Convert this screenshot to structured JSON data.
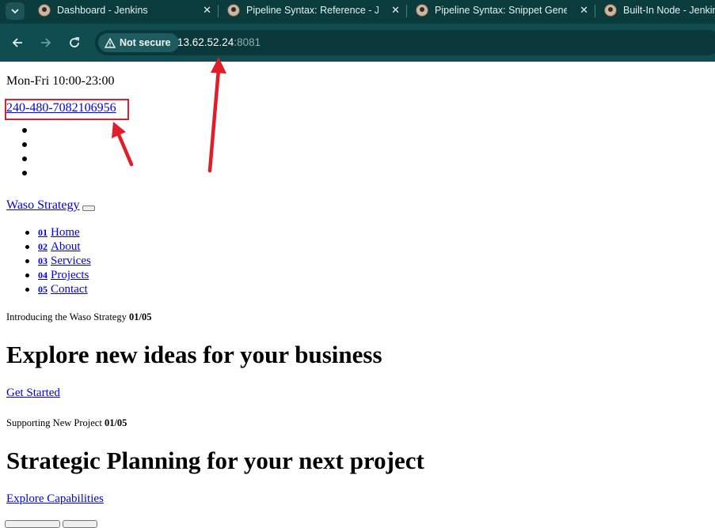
{
  "browser": {
    "tabs": [
      {
        "title": "Dashboard - Jenkins"
      },
      {
        "title": "Pipeline Syntax: Reference - Jenkins"
      },
      {
        "title": "Pipeline Syntax: Snippet Generator"
      },
      {
        "title": "Built-In Node - Jenkins"
      }
    ],
    "security_label": "Not secure",
    "url_host": "13.62.52.24",
    "url_port": ":8081",
    "icons": {
      "menu": "chevron-down-icon",
      "back": "back-arrow-icon",
      "forward": "forward-arrow-icon",
      "reload": "reload-icon",
      "warning": "warning-triangle-icon",
      "close": "close-icon",
      "favicon": "jenkins-favicon-icon"
    }
  },
  "page": {
    "hours": "Mon-Fri 10:00-23:00",
    "phone": "240-480-7082106956",
    "brand": "Waso Strategy",
    "menu": [
      {
        "num": "01",
        "label": "Home"
      },
      {
        "num": "02",
        "label": "About"
      },
      {
        "num": "03",
        "label": "Services"
      },
      {
        "num": "04",
        "label": "Projects"
      },
      {
        "num": "05",
        "label": "Contact"
      }
    ],
    "slides": [
      {
        "kicker": "Introducing the Waso Strategy",
        "counter": "01/05",
        "heading": "Explore new ideas for your business",
        "cta": "Get Started"
      },
      {
        "kicker": "Supporting New Project",
        "counter": "01/05",
        "heading": "Strategic Planning for your next project",
        "cta": "Explore Capabilities"
      }
    ]
  },
  "annotation_color": "#e11d2a"
}
